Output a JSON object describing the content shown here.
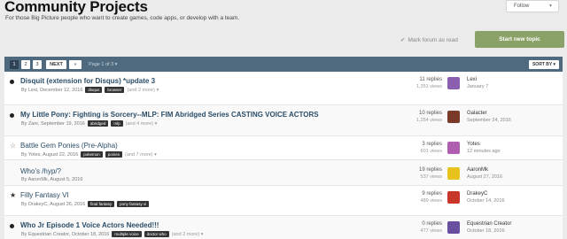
{
  "header": {
    "title": "Community Projects",
    "description": "For those Big Picture people who want to create games, code apps, or develop with a team.",
    "follow_label": "Follow",
    "mark_read_label": "Mark forum as read",
    "new_topic_label": "Start new topic"
  },
  "toolbar": {
    "pages": [
      "1",
      "2",
      "3"
    ],
    "next_label": "NEXT",
    "last_label": "»",
    "page_info": "Page 1 of 3 ▾",
    "sort_label": "SORT BY ▾"
  },
  "topics": [
    {
      "title": "Disquit (extension for Disqus) *update 3",
      "meta": "By Lexi, December 12, 2016",
      "tags": [
        "disqus",
        "browser"
      ],
      "more": "(and 2 more) ▾",
      "replies": "11 replies",
      "views": "1,351 views",
      "last_user": "Lexi",
      "last_date": "January 7",
      "marker": "dot",
      "avatar_color": "#8a5fb0"
    },
    {
      "title": "My Little Pony: Fighting is Sorcery--MLP: FIM Abridged Series CASTING VOICE ACTORS",
      "meta": "By Zanr, September 19, 2016",
      "tags": [
        "abridged",
        "mlp"
      ],
      "more": "(and 4 more) ▾",
      "replies": "10 replies",
      "views": "1,254 views",
      "last_user": "Galacter",
      "last_date": "September 24, 2016",
      "marker": "dot",
      "avatar_color": "#7a3a2a"
    },
    {
      "title": "Battle Gem Ponies (Pre-Alpha)",
      "meta": "By Yotes, August 22, 2016",
      "tags": [
        "pokemon",
        "ponies"
      ],
      "more": "(and 7 more) ▾",
      "replies": "3 replies",
      "views": "601 views",
      "last_user": "Yotes",
      "last_date": "12 minutes ago",
      "marker": "star-outline",
      "avatar_color": "#b05fb0"
    },
    {
      "title": "Who's /hyp/?",
      "meta": "By AaronMk, August 5, 2016",
      "tags": [],
      "more": "",
      "replies": "19 replies",
      "views": "537 views",
      "last_user": "AaronMk",
      "last_date": "August 27, 2016",
      "marker": "none",
      "avatar_color": "#e7c21a"
    },
    {
      "title": "Filly Fantasy VI",
      "meta": "By DrakeyC, August 26, 2016",
      "tags": [
        "final fantasy",
        "pony fantasy vi"
      ],
      "more": "",
      "replies": "9 replies",
      "views": "489 views",
      "last_user": "DrakeyC",
      "last_date": "October 14, 2016",
      "marker": "star",
      "avatar_color": "#c8372a"
    },
    {
      "title": "Who Jr Episode 1 Voice Actors Needed!!!",
      "meta": "By Equestrian Creator, October 18, 2016",
      "tags": [
        "multiple voice",
        "doctor who"
      ],
      "more": "(and 2 more) ▾",
      "replies": "0 replies",
      "views": "477 views",
      "last_user": "Equestrian Creator",
      "last_date": "October 18, 2016",
      "marker": "dot",
      "avatar_color": "#6a4fa0"
    }
  ]
}
